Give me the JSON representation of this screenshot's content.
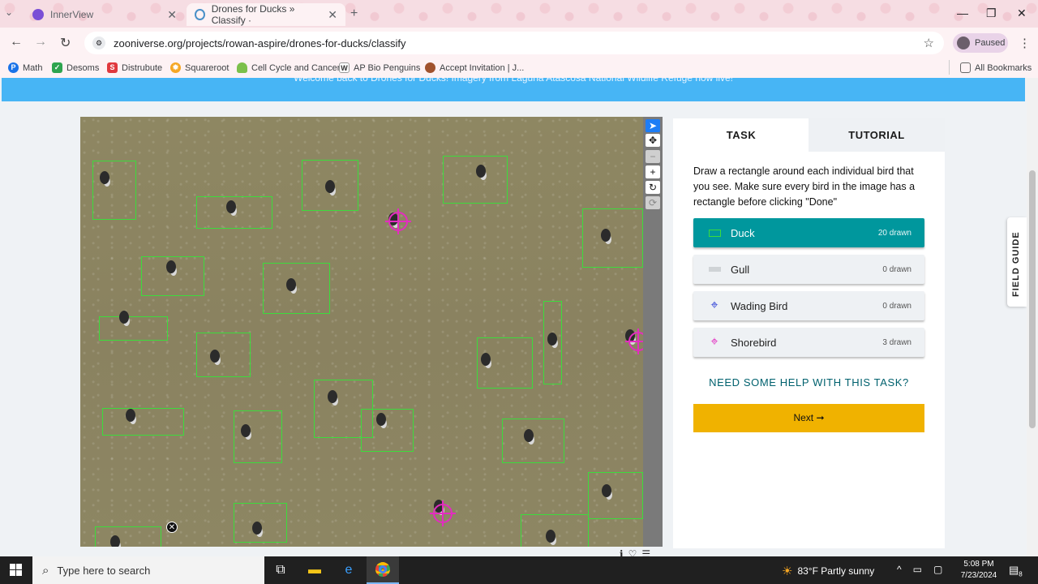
{
  "browser": {
    "tabs": [
      {
        "title": "InnerView",
        "close": "✕"
      },
      {
        "title": "Drones for Ducks » Classify ·",
        "close": "✕"
      }
    ],
    "new_tab": "+",
    "window_controls": {
      "minimize": "—",
      "maximize": "❐",
      "close": "✕"
    },
    "url": "zooniverse.org/projects/rowan-aspire/drones-for-ducks/classify",
    "profile_status": "Paused",
    "bookmarks": [
      "Math",
      "Desoms",
      "Distrubute",
      "Squareroot",
      "Cell Cycle and Cancer",
      "AP Bio Penguins",
      "Accept Invitation | J..."
    ],
    "all_bookmarks": "All Bookmarks"
  },
  "banner": {
    "text": "Welcome back to Drones for Ducks! Imagery from Laguna Atascosa National Wildlife Refuge now live!"
  },
  "viewer": {
    "tools": [
      "pointer",
      "pan",
      "zoom-out",
      "zoom-in",
      "rotate",
      "reset"
    ]
  },
  "task_panel": {
    "tabs": {
      "task": "TASK",
      "tutorial": "TUTORIAL"
    },
    "instructions": "Draw a rectangle around each individual bird that you see. Make sure every bird in the image has a rectangle before clicking \"Done\"",
    "choices": [
      {
        "label": "Duck",
        "count": "20 drawn",
        "icon": "rectangle-icon",
        "selected": true
      },
      {
        "label": "Gull",
        "count": "0 drawn",
        "icon": "rectangle-icon",
        "selected": false
      },
      {
        "label": "Wading Bird",
        "count": "0 drawn",
        "icon": "crosshair-icon",
        "selected": false
      },
      {
        "label": "Shorebird",
        "count": "3 drawn",
        "icon": "crosshair-icon",
        "selected": false
      }
    ],
    "help": "NEED SOME HELP WITH THIS TASK?",
    "next": "Next ➞"
  },
  "field_guide": "FIELD GUIDE",
  "colors": {
    "duck": "#3cdc3c",
    "shorebird": "#e32cc0",
    "wading": "#2c3fd6",
    "selected": "#00979d",
    "next": "#f0b200",
    "banner": "#47b5f5"
  },
  "taskbar": {
    "search_placeholder": "Type here to search",
    "weather": "83°F  Partly sunny",
    "time": "5:08 PM",
    "date": "7/23/2024",
    "notifications": "8"
  }
}
